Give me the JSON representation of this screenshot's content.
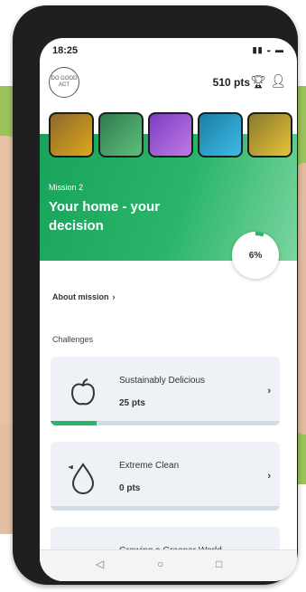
{
  "status_bar": {
    "time": "18:25",
    "icons": "▮▮ ◒ ▬"
  },
  "header": {
    "logo_text": "DO GOOD ACT",
    "points": "510 pts",
    "trophy_icon": "trophy-icon",
    "profile_icon": "profile-icon"
  },
  "mission": {
    "label": "Mission 2",
    "title": "Your home - your decision",
    "progress": "6%",
    "progress_value": 0.06,
    "about_label": "About mission",
    "about_chevron": "›"
  },
  "challenges": {
    "section_label": "Challenges",
    "items": [
      {
        "title": "Sustainably Delicious",
        "points": "25 pts",
        "icon": "apple-icon",
        "progress_value": 0.2
      },
      {
        "title": "Extreme Clean",
        "points": "0 pts",
        "icon": "water-drop-icon",
        "progress_value": 0.0
      },
      {
        "title": "Growing a Greener World",
        "points": "",
        "icon": "plant-icon",
        "progress_value": 0.0
      }
    ]
  },
  "navbar": {
    "back": "◁",
    "home": "○",
    "recent": "□"
  },
  "colors": {
    "accent_green": "#29b56a",
    "card_bg": "#eef2f6",
    "phone_frame": "#1f1f22"
  }
}
